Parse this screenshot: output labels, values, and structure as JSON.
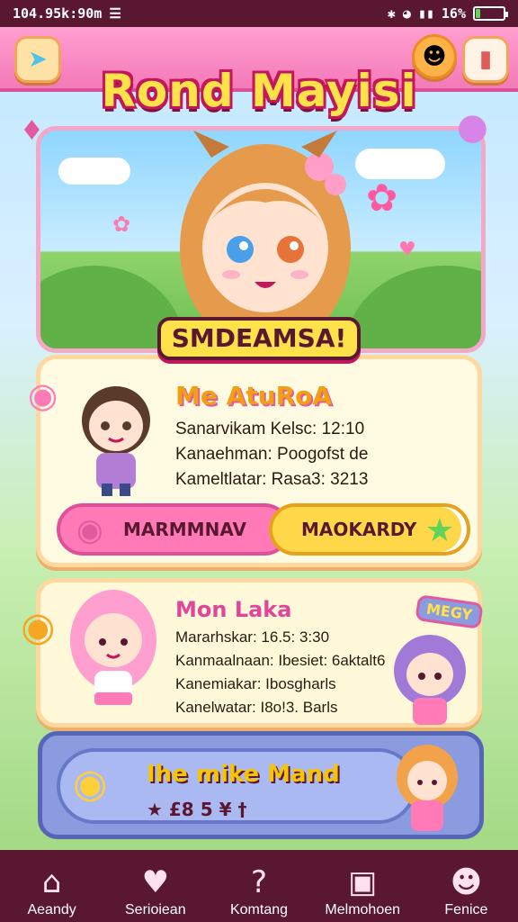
{
  "status_bar": {
    "time": "104.95k:90m",
    "battery": "16%",
    "battery_level": 0.16
  },
  "app": {
    "title": "Rond Mayisi",
    "hero_banner": "SMDEAMSA!"
  },
  "card1": {
    "title": "Me AtuRoA",
    "lines": [
      "Sanarvikam Kelsc: 12:10",
      "Kanaehman: Poogofst de",
      "Kameltlatar: Rasa3: 3213"
    ],
    "btn_left": "MARMMNAV",
    "btn_right": "MAOKARDY"
  },
  "card2": {
    "title": "Mon Laka",
    "lines": [
      "Mararhskar: 16.5: 3:30",
      "Kanmaalnaan: Ibesiet: 6aktalt6",
      "Kanemiakar: Ibosgharls",
      "Kanelwatar: I8o!3. Barls"
    ],
    "sign": "MEGY"
  },
  "banner": {
    "title": "Ihe mike Mand",
    "sub": "★ £8 5 ¥ †"
  },
  "nav": [
    {
      "label": "Aeandy",
      "icon": "home-icon"
    },
    {
      "label": "Serioiean",
      "icon": "tooth-heart-icon"
    },
    {
      "label": "Komtang",
      "icon": "question-icon"
    },
    {
      "label": "Melmohoen",
      "icon": "calendar-icon"
    },
    {
      "label": "Fenice",
      "icon": "ghost-icon"
    }
  ]
}
